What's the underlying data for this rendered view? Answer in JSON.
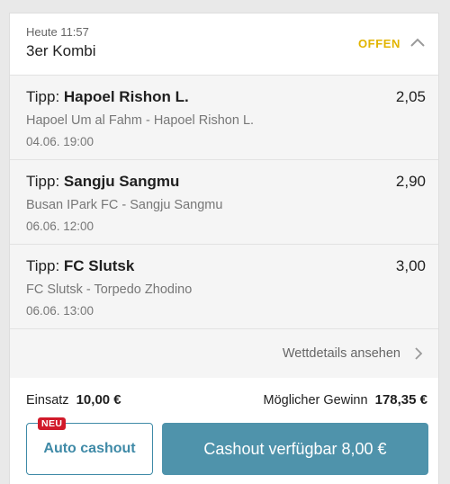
{
  "header": {
    "time": "Heute 11:57",
    "title": "3er Kombi",
    "status": "OFFEN",
    "status_color": "#e2b400"
  },
  "tips": [
    {
      "prefix": "Tipp:",
      "selection": "Hapoel Rishon L.",
      "odds": "2,05",
      "match": "Hapoel Um al Fahm - Hapoel Rishon L.",
      "date": "04.06. 19:00"
    },
    {
      "prefix": "Tipp:",
      "selection": "Sangju Sangmu",
      "odds": "2,90",
      "match": "Busan IPark FC - Sangju Sangmu",
      "date": "06.06. 12:00"
    },
    {
      "prefix": "Tipp:",
      "selection": "FC Slutsk",
      "odds": "3,00",
      "match": "FC Slutsk - Torpedo Zhodino",
      "date": "06.06. 13:00"
    }
  ],
  "details_link": "Wettdetails ansehen",
  "footer": {
    "stake_label": "Einsatz",
    "stake_value": "10,00 €",
    "win_label": "Möglicher Gewinn",
    "win_value": "178,35 €",
    "auto_cashout_label": "Auto cashout",
    "new_badge": "NEU",
    "cashout_label": "Cashout verfügbar 8,00 €"
  },
  "colors": {
    "accent": "#4f93ab",
    "badge": "#d11a2a"
  },
  "icons": {
    "collapse": "chevron-up-icon",
    "details": "chevron-right-icon"
  }
}
